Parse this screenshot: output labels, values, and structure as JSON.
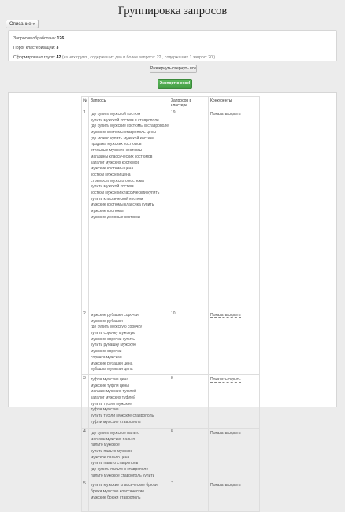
{
  "toolbar": {
    "description_label": "Описание"
  },
  "page": {
    "title": "Группировка запросов"
  },
  "stats": {
    "processed_label": "Запросов обработано:",
    "processed_value": "126",
    "threshold_label": "Порог кластеризации:",
    "threshold_value": "3",
    "groups_label": "Сформировано групп:",
    "groups_value": "42",
    "groups_note": "(из них групп , содержащих два и более запроса: 22 , содержащих 1 запрос: 20 )"
  },
  "actions": {
    "expand_all_label": "Развернуть/свернуть все",
    "export_label": "Экспорт в excel"
  },
  "table": {
    "headers": [
      "№",
      "Запросы",
      "Запросов в кластере",
      "Конкуренты"
    ],
    "show_hide_label": "Показать/скрыть",
    "rows": [
      {
        "n": "1",
        "count": "19",
        "queries": [
          "где купить мужской костюм",
          "купить мужской костюм в ставрополе",
          "где купить мужские костюмы в ставрополе",
          "мужские костюмы ставрополь цены",
          "где можно купить мужской костюм",
          "продажа мужских костюмов",
          "стильные мужские костюмы",
          "магазины классических костюмов",
          "каталог мужских костюмов",
          "мужские костюмы цена",
          "костюм мужской цена",
          "стоимость мужского костюма",
          "купить мужской костюм",
          "костюм мужской классический купить",
          "купить классический костюм",
          "мужские костюмы классика купить",
          "мужские костюмы",
          "мужские деловые костюмы"
        ]
      },
      {
        "n": "2",
        "count": "10",
        "queries": [
          "мужские рубашки сорочки",
          "мужские рубашки",
          "где купить мужскую сорочку",
          "купить сорочку мужскую",
          "мужские сорочки купить",
          "купить рубашку мужскую",
          "мужские сорочки",
          "сорочка мужская",
          "мужские рубашки цена",
          "рубашка мужская цена"
        ]
      },
      {
        "n": "3",
        "count": "8",
        "queries": [
          "туфли мужские цена",
          "мужские туфли цены",
          "магазин мужских туфлей",
          "каталог мужских туфлей",
          "купить туфли мужские",
          "туфли мужские",
          "купить туфли мужские ставрополь",
          "туфли мужские ставрополь"
        ]
      },
      {
        "n": "4",
        "count": "8",
        "queries": [
          "где купить мужское пальто",
          "магазин мужских пальто",
          "пальто мужское",
          "купить пальто мужское",
          "мужское пальто цена",
          "купить пальто ставрополь",
          "где купить пальто в ставрополе",
          "пальто мужское ставрополь купить"
        ]
      },
      {
        "n": "5",
        "count": "7",
        "queries": [
          "купить мужские классические брюки",
          "брюки мужские классические",
          "мужские брюки ставрополь"
        ]
      }
    ]
  }
}
